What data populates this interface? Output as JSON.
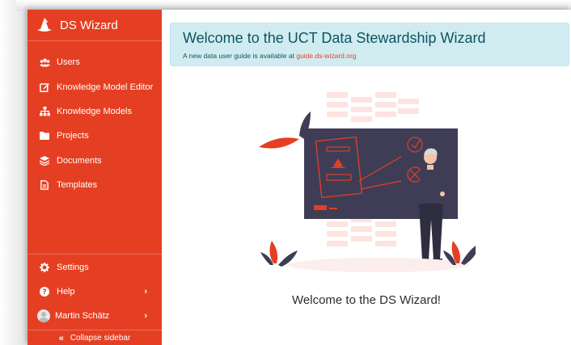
{
  "brand": {
    "name": "DS Wizard"
  },
  "sidebar": {
    "items": [
      {
        "label": "Users",
        "icon": "users-icon"
      },
      {
        "label": "Knowledge Model Editor",
        "icon": "edit-icon"
      },
      {
        "label": "Knowledge Models",
        "icon": "sitemap-icon"
      },
      {
        "label": "Projects",
        "icon": "folder-icon"
      },
      {
        "label": "Documents",
        "icon": "stack-icon"
      },
      {
        "label": "Templates",
        "icon": "file-icon"
      }
    ],
    "bottom": {
      "settings": "Settings",
      "help": "Help",
      "user": "Martin Schätz"
    },
    "collapse": "Collapse sidebar"
  },
  "alert": {
    "title": "Welcome to the UCT Data Stewardship Wizard",
    "text_prefix": "A new data user guide is available at ",
    "link": "guide.ds-wizard.org"
  },
  "welcome": "Welcome to the DS Wizard!",
  "colors": {
    "sidebar": "#e53f23",
    "alert_bg": "#d1ecf1",
    "alert_text": "#0c5460",
    "board": "#3f3d56"
  }
}
